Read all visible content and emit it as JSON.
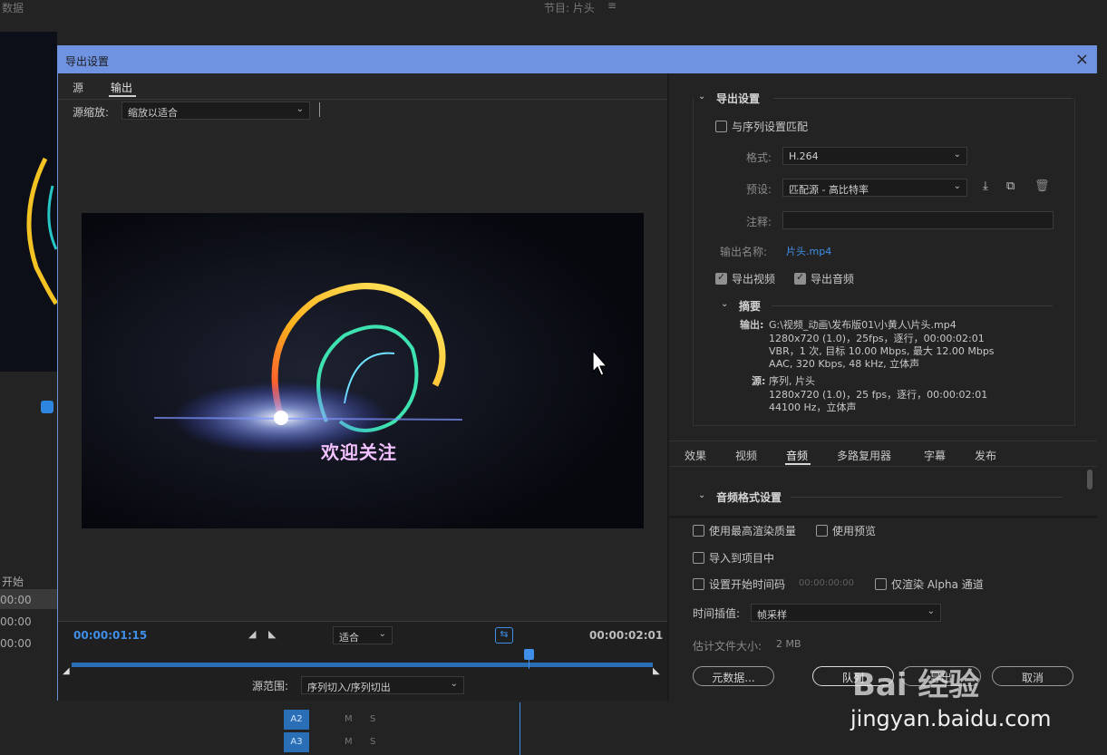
{
  "bg": {
    "left_title": "数据",
    "right_title": "节目: 片头",
    "list_header": "开始",
    "list_rows": [
      "00:00",
      "00:00",
      "00:00"
    ],
    "tracks": [
      "A2",
      "A3"
    ],
    "track_m": "M",
    "track_s": "S"
  },
  "dialog": {
    "title": "导出设置",
    "close": "×",
    "tabs": [
      "源",
      "输出"
    ],
    "source_scale_label": "源缩放:",
    "source_scale_value": "缩放以适合",
    "preview_text": "欢迎关注",
    "timecode_current": "00:00:01:15",
    "timecode_end": "00:00:02:01",
    "fit_value": "适合",
    "source_range_label": "源范围:",
    "source_range_value": "序列切入/序列切出"
  },
  "export": {
    "section_title": "导出设置",
    "match_sequence": "与序列设置匹配",
    "format_label": "格式:",
    "format_value": "H.264",
    "preset_label": "预设:",
    "preset_value": "匹配源 - 高比特率",
    "comment_label": "注释:",
    "output_name_label": "输出名称:",
    "output_name_value": "片头.mp4",
    "export_video": "导出视频",
    "export_audio": "导出音频",
    "summary_title": "摘要",
    "summary_output_label": "输出:",
    "summary_output_lines": [
      "G:\\视频_动画\\发布版01\\小黄人\\片头.mp4",
      "1280x720 (1.0)，25fps，逐行，00:00:02:01",
      "VBR，1 次, 目标 10.00 Mbps, 最大 12.00 Mbps",
      "AAC, 320 Kbps, 48 kHz, 立体声"
    ],
    "summary_source_label": "源:",
    "summary_source_lines": [
      "序列, 片头",
      "1280x720 (1.0)，25 fps，逐行，00:00:02:01",
      "44100 Hz，立体声"
    ]
  },
  "tabs2": [
    "效果",
    "视频",
    "音频",
    "多路复用器",
    "字幕",
    "发布"
  ],
  "audio_section": "音频格式设置",
  "bottom": {
    "max_render": "使用最高渲染质量",
    "use_preview": "使用预览",
    "import_project": "导入到项目中",
    "set_start_tc": "设置开始时间码",
    "start_tc_value": "00:00:00:00",
    "alpha_only": "仅渲染 Alpha 通道",
    "time_interp_label": "时间插值:",
    "time_interp_value": "帧采样",
    "file_size_label": "估计文件大小:",
    "file_size_value": "2 MB",
    "metadata_btn": "元数据...",
    "queue_btn": "队列",
    "export_btn": "导出",
    "cancel_btn": "取消"
  },
  "watermark": {
    "brand": "Bai 经验",
    "url": "jingyan.baidu.com"
  }
}
